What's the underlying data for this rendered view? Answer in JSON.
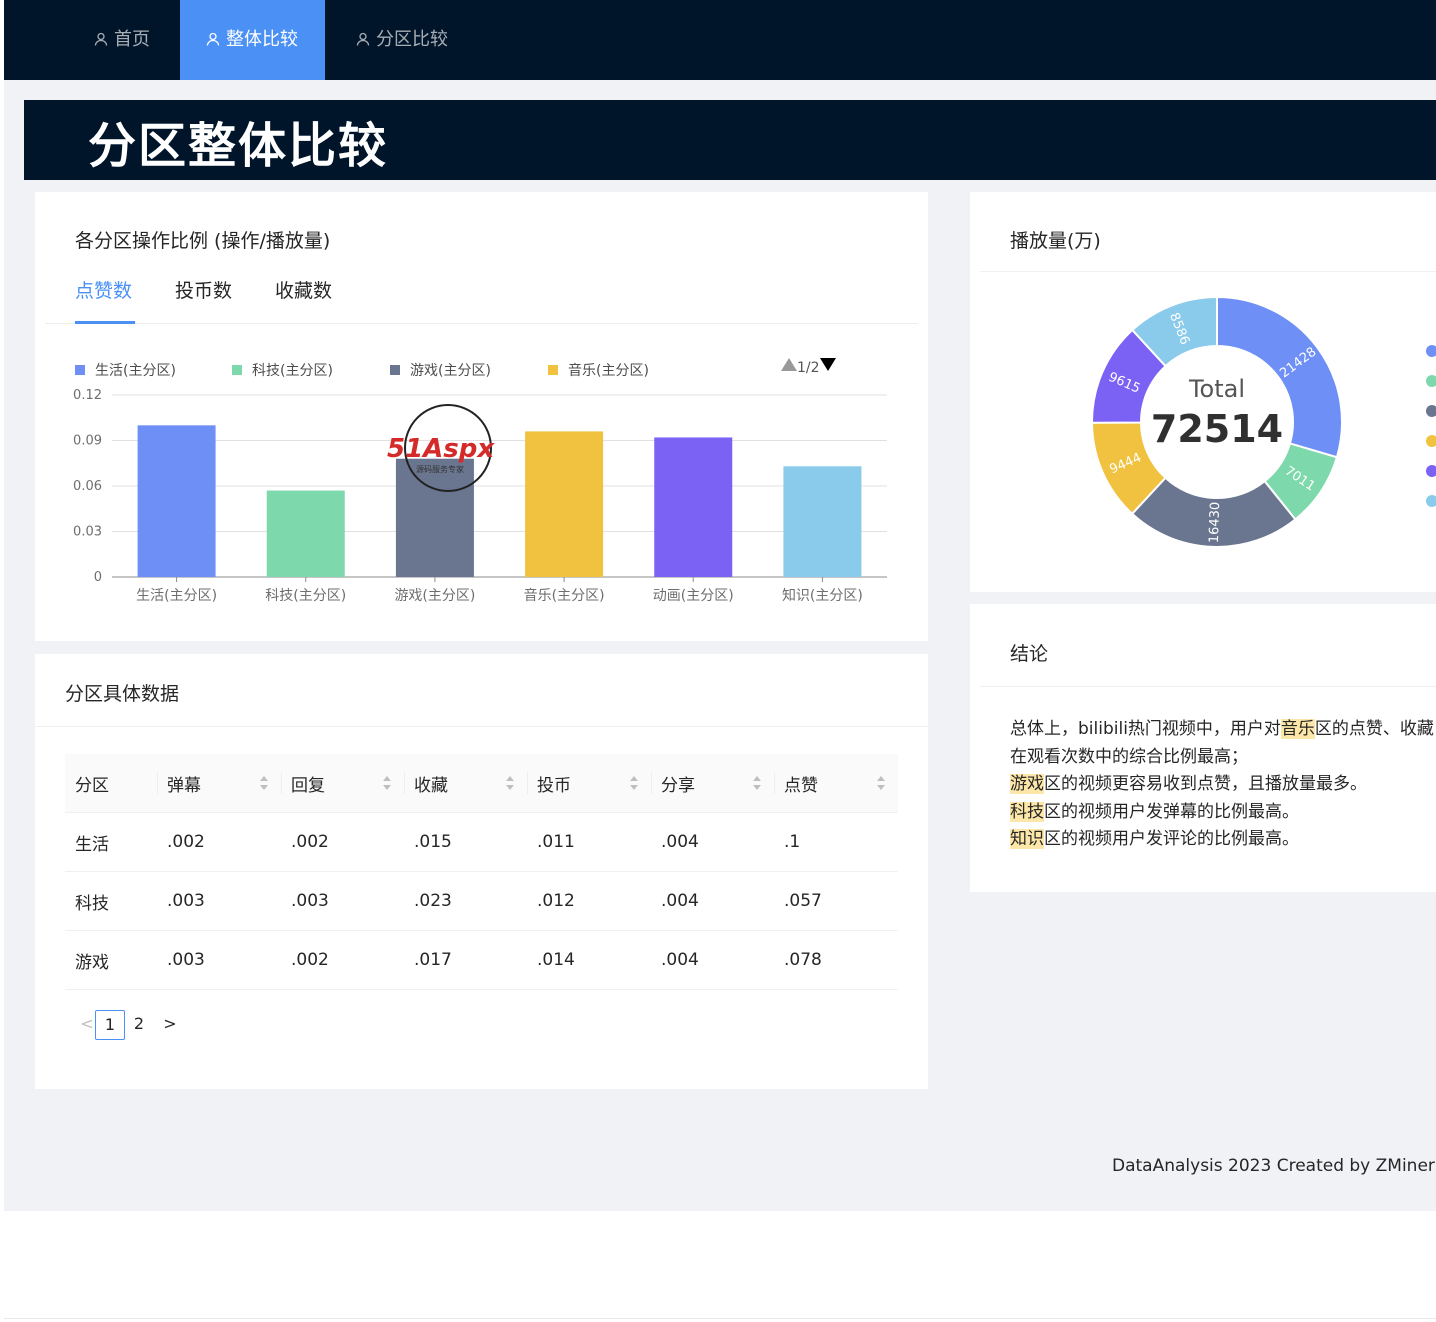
{
  "nav": {
    "items": [
      {
        "label": "首页"
      },
      {
        "label": "整体比较"
      },
      {
        "label": "分区比较"
      }
    ],
    "active_index": 1
  },
  "banner": {
    "title": "分区整体比较"
  },
  "ratio_card": {
    "title": "各分区操作比例 (操作/播放量)",
    "tabs": [
      {
        "label": "点赞数"
      },
      {
        "label": "投币数"
      },
      {
        "label": "收藏数"
      }
    ],
    "legend_page": "1/2"
  },
  "chart_data": [
    {
      "type": "bar",
      "categories": [
        "生活(主分区)",
        "科技(主分区)",
        "游戏(主分区)",
        "音乐(主分区)",
        "动画(主分区)",
        "知识(主分区)"
      ],
      "values": [
        0.1,
        0.057,
        0.078,
        0.096,
        0.092,
        0.073
      ],
      "colors": [
        "#6e8ff5",
        "#7dd9ab",
        "#6a7690",
        "#f0c240",
        "#7b61f4",
        "#8acaeb"
      ],
      "legend": [
        "生活(主分区)",
        "科技(主分区)",
        "游戏(主分区)",
        "音乐(主分区)"
      ],
      "legend_placement": "top",
      "ylim": [
        0,
        0.12
      ],
      "yticks": [
        "0",
        "0.03",
        "0.06",
        "0.09",
        "0.12"
      ],
      "grid": true
    },
    {
      "type": "pie",
      "title": "播放量(万)",
      "center_label": "Total",
      "center_value": "72514",
      "values": [
        21428,
        7011,
        16430,
        9444,
        9615,
        8586
      ],
      "colors": [
        "#6e8ff5",
        "#7dd9ab",
        "#6a7690",
        "#f0c240",
        "#7b61f4",
        "#8acaeb"
      ]
    }
  ],
  "table_card": {
    "title": "分区具体数据",
    "columns": [
      "分区",
      "弹幕",
      "回复",
      "收藏",
      "投币",
      "分享",
      "点赞"
    ],
    "rows": [
      [
        "生活",
        ".002",
        ".002",
        ".015",
        ".011",
        ".004",
        ".1"
      ],
      [
        "科技",
        ".003",
        ".003",
        ".023",
        ".012",
        ".004",
        ".057"
      ],
      [
        "游戏",
        ".003",
        ".002",
        ".017",
        ".014",
        ".004",
        ".078"
      ]
    ],
    "pagination": {
      "prev": "<",
      "pages": [
        "1",
        "2"
      ],
      "current": "1",
      "next": ">"
    }
  },
  "conclusion_card": {
    "title": "结论",
    "line1_pre": "总体上，bilibili热门视频中，用户对",
    "line1_hl": "音乐",
    "line1_post": "区的点赞、收藏",
    "line2": "在观看次数中的综合比例最高；",
    "line3_hl": "游戏",
    "line3_post": "区的视频更容易收到点赞，且播放量最多。",
    "line4_hl": "科技",
    "line4_post": "区的视频用户发弹幕的比例最高。",
    "line5_hl": "知识",
    "line5_post": "区的视频用户发评论的比例最高。"
  },
  "watermark": {
    "brand": "51Aspx",
    "sub": "源码服务专家"
  },
  "footer": {
    "text": "DataAnalysis 2023 Created by ZMiner"
  }
}
